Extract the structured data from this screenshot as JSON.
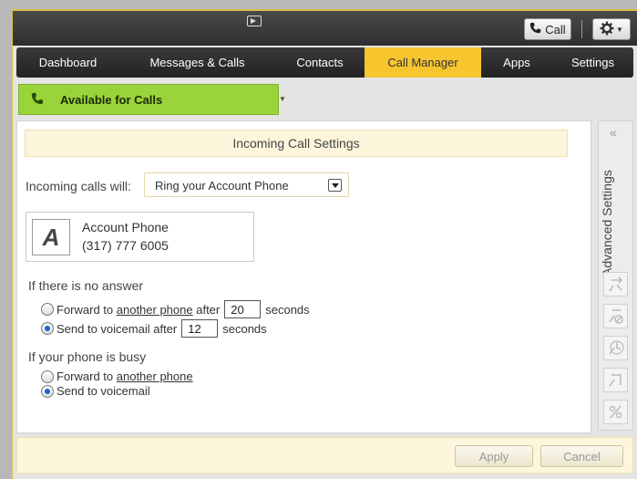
{
  "toolbar": {
    "call_label": "Call"
  },
  "tabs": [
    {
      "label": "Dashboard"
    },
    {
      "label": "Messages & Calls"
    },
    {
      "label": "Contacts"
    },
    {
      "label": "Call Manager"
    },
    {
      "label": "Apps"
    },
    {
      "label": "Settings"
    }
  ],
  "status": {
    "label": "Available for Calls"
  },
  "section": {
    "title": "Incoming Call Settings"
  },
  "incoming": {
    "label": "Incoming calls will:",
    "selected": "Ring your Account Phone"
  },
  "account": {
    "letter": "A",
    "name": "Account Phone",
    "number": "(317) 777 6005"
  },
  "no_answer": {
    "title": "If there is no answer",
    "forward_prefix": "Forward to ",
    "forward_link": "another phone",
    "forward_after": " after",
    "forward_seconds": "20",
    "seconds_label": "seconds",
    "voicemail_label": "Send to voicemail after",
    "voicemail_seconds": "12"
  },
  "busy": {
    "title": "If your phone is busy",
    "forward_prefix": "Forward to ",
    "forward_link": "another phone",
    "voicemail_label": "Send to voicemail"
  },
  "sidebar": {
    "collapse": "«",
    "title": "Advanced Settings"
  },
  "footer": {
    "apply_label": "Apply",
    "cancel_label": "Cancel"
  },
  "colors": {
    "active_tab": "#f7c52e",
    "status_green": "#99d43a",
    "radio_selected": "#1e5fd6"
  }
}
